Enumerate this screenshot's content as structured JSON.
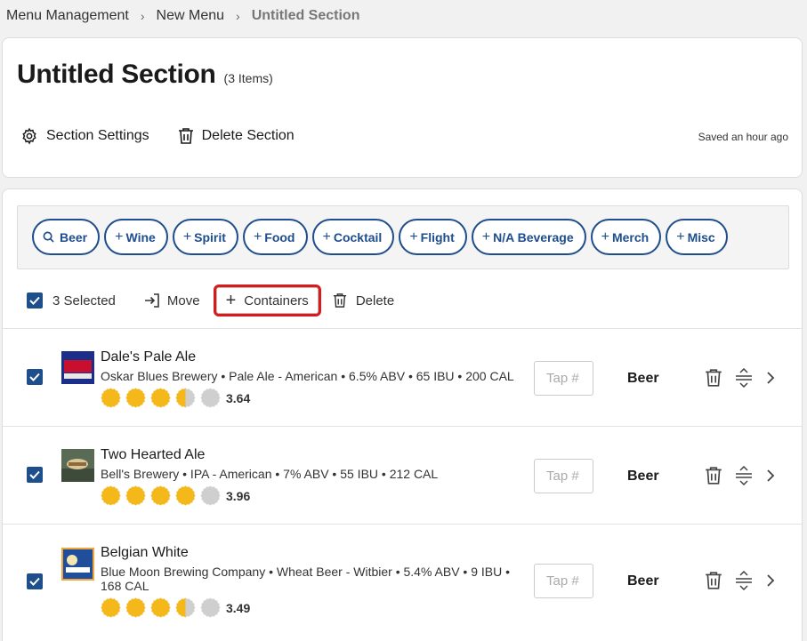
{
  "breadcrumb": {
    "items": [
      "Menu Management",
      "New Menu",
      "Untitled Section"
    ]
  },
  "section": {
    "title": "Untitled Section",
    "count": "(3 Items)",
    "settings_label": "Section Settings",
    "delete_label": "Delete Section",
    "saved_text": "Saved an hour ago"
  },
  "filters": {
    "search_label": "Beer",
    "pills": [
      "Wine",
      "Spirit",
      "Food",
      "Cocktail",
      "Flight",
      "N/A Beverage",
      "Merch",
      "Misc"
    ]
  },
  "toolbar": {
    "selected_label": "3 Selected",
    "move_label": "Move",
    "containers_label": "Containers",
    "delete_label": "Delete"
  },
  "items": [
    {
      "name": "Dale's Pale Ale",
      "meta": "Oskar Blues Brewery • Pale Ale - American • 6.5% ABV • 65 IBU • 200 CAL",
      "rating": 3.64,
      "rating_text": "3.64",
      "tap_placeholder": "Tap #",
      "type": "Beer"
    },
    {
      "name": "Two Hearted Ale",
      "meta": "Bell's Brewery • IPA - American • 7% ABV • 55 IBU • 212 CAL",
      "rating": 3.96,
      "rating_text": "3.96",
      "tap_placeholder": "Tap #",
      "type": "Beer"
    },
    {
      "name": "Belgian White",
      "meta": "Blue Moon Brewing Company • Wheat Beer - Witbier • 5.4% ABV • 9 IBU • 168 CAL",
      "rating": 3.49,
      "rating_text": "3.49",
      "tap_placeholder": "Tap #",
      "type": "Beer"
    }
  ],
  "colors": {
    "accent": "#1f4e8c",
    "highlight": "#d81a1a",
    "star": "#f5b81a",
    "star_empty": "#cfcfcf"
  }
}
